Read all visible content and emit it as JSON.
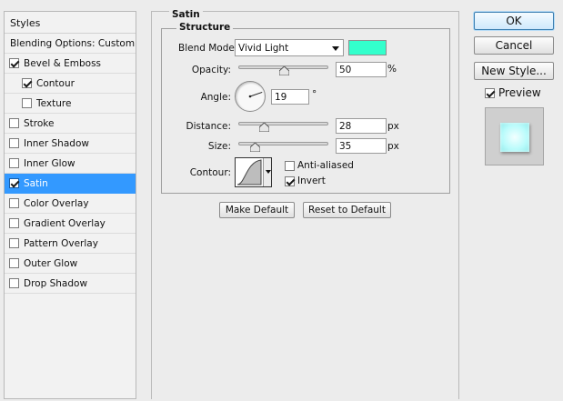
{
  "styles_panel": {
    "header": "Styles",
    "items": [
      {
        "label": "Blending Options: Custom",
        "checkbox": false,
        "checked": false,
        "indent": 0,
        "selected": false
      },
      {
        "label": "Bevel & Emboss",
        "checkbox": true,
        "checked": true,
        "indent": 0,
        "selected": false
      },
      {
        "label": "Contour",
        "checkbox": true,
        "checked": true,
        "indent": 1,
        "selected": false
      },
      {
        "label": "Texture",
        "checkbox": true,
        "checked": false,
        "indent": 1,
        "selected": false
      },
      {
        "label": "Stroke",
        "checkbox": true,
        "checked": false,
        "indent": 0,
        "selected": false
      },
      {
        "label": "Inner Shadow",
        "checkbox": true,
        "checked": false,
        "indent": 0,
        "selected": false
      },
      {
        "label": "Inner Glow",
        "checkbox": true,
        "checked": false,
        "indent": 0,
        "selected": false
      },
      {
        "label": "Satin",
        "checkbox": true,
        "checked": true,
        "indent": 0,
        "selected": true
      },
      {
        "label": "Color Overlay",
        "checkbox": true,
        "checked": false,
        "indent": 0,
        "selected": false
      },
      {
        "label": "Gradient Overlay",
        "checkbox": true,
        "checked": false,
        "indent": 0,
        "selected": false
      },
      {
        "label": "Pattern Overlay",
        "checkbox": true,
        "checked": false,
        "indent": 0,
        "selected": false
      },
      {
        "label": "Outer Glow",
        "checkbox": true,
        "checked": false,
        "indent": 0,
        "selected": false
      },
      {
        "label": "Drop Shadow",
        "checkbox": true,
        "checked": false,
        "indent": 0,
        "selected": false
      }
    ]
  },
  "satin": {
    "group_title": "Satin",
    "structure_title": "Structure",
    "blend_mode": {
      "label": "Blend Mode:",
      "value": "Vivid Light"
    },
    "color": "#33ffcc",
    "opacity": {
      "label": "Opacity:",
      "value": "50",
      "unit": "%",
      "slider_fraction": 0.5
    },
    "angle": {
      "label": "Angle:",
      "value": "19",
      "unit": "°",
      "degrees": 19
    },
    "distance": {
      "label": "Distance:",
      "value": "28",
      "unit": "px",
      "slider_fraction": 0.28
    },
    "size": {
      "label": "Size:",
      "value": "35",
      "unit": "px",
      "slider_fraction": 0.18
    },
    "contour": {
      "label": "Contour:",
      "icon": "contour-curve-icon"
    },
    "anti_aliased": {
      "label": "Anti-aliased",
      "checked": false
    },
    "invert": {
      "label": "Invert",
      "checked": true
    },
    "make_default": "Make Default",
    "reset_default": "Reset to Default"
  },
  "actions": {
    "ok": "OK",
    "cancel": "Cancel",
    "new_style": "New Style...",
    "preview": {
      "label": "Preview",
      "checked": true
    }
  }
}
